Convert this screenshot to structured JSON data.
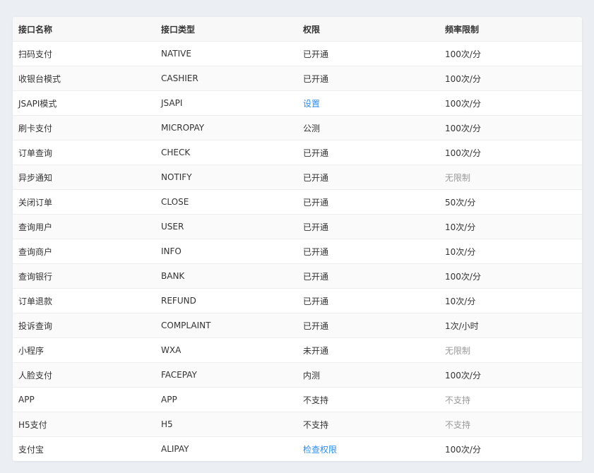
{
  "colors": {
    "link": "#2d8cf0",
    "muted": "#999999",
    "text": "#333333"
  },
  "table": {
    "headers": [
      "接口名称",
      "接口类型",
      "权限",
      "频率限制"
    ],
    "rows": [
      {
        "name": "扫码支付",
        "type": "NATIVE",
        "permission": "已开通",
        "permission_style": "text",
        "rate": "100次/分",
        "rate_style": "text"
      },
      {
        "name": "收银台模式",
        "type": "CASHIER",
        "permission": "已开通",
        "permission_style": "text",
        "rate": "100次/分",
        "rate_style": "text"
      },
      {
        "name": "JSAPI模式",
        "type": "JSAPI",
        "permission": "设置",
        "permission_style": "link",
        "rate": "100次/分",
        "rate_style": "text"
      },
      {
        "name": "刷卡支付",
        "type": "MICROPAY",
        "permission": "公测",
        "permission_style": "text",
        "rate": "100次/分",
        "rate_style": "text"
      },
      {
        "name": "订单查询",
        "type": "CHECK",
        "permission": "已开通",
        "permission_style": "text",
        "rate": "100次/分",
        "rate_style": "text"
      },
      {
        "name": "异步通知",
        "type": "NOTIFY",
        "permission": "已开通",
        "permission_style": "text",
        "rate": "无限制",
        "rate_style": "muted"
      },
      {
        "name": "关闭订单",
        "type": "CLOSE",
        "permission": "已开通",
        "permission_style": "text",
        "rate": "50次/分",
        "rate_style": "text"
      },
      {
        "name": "查询用户",
        "type": "USER",
        "permission": "已开通",
        "permission_style": "text",
        "rate": "10次/分",
        "rate_style": "text"
      },
      {
        "name": "查询商户",
        "type": "INFO",
        "permission": "已开通",
        "permission_style": "text",
        "rate": "10次/分",
        "rate_style": "text"
      },
      {
        "name": "查询银行",
        "type": "BANK",
        "permission": "已开通",
        "permission_style": "text",
        "rate": "100次/分",
        "rate_style": "text"
      },
      {
        "name": "订单退款",
        "type": "REFUND",
        "permission": "已开通",
        "permission_style": "text",
        "rate": "10次/分",
        "rate_style": "text"
      },
      {
        "name": "投诉查询",
        "type": "COMPLAINT",
        "permission": "已开通",
        "permission_style": "text",
        "rate": "1次/小时",
        "rate_style": "text"
      },
      {
        "name": "小程序",
        "type": "WXA",
        "permission": "未开通",
        "permission_style": "text",
        "rate": "无限制",
        "rate_style": "muted"
      },
      {
        "name": "人脸支付",
        "type": "FACEPAY",
        "permission": "内测",
        "permission_style": "text",
        "rate": "100次/分",
        "rate_style": "text"
      },
      {
        "name": "APP",
        "type": "APP",
        "permission": "不支持",
        "permission_style": "text",
        "rate": "不支持",
        "rate_style": "muted"
      },
      {
        "name": "H5支付",
        "type": "H5",
        "permission": "不支持",
        "permission_style": "text",
        "rate": "不支持",
        "rate_style": "muted"
      },
      {
        "name": "支付宝",
        "type": "ALIPAY",
        "permission": "检查权限",
        "permission_style": "link",
        "rate": "100次/分",
        "rate_style": "text"
      }
    ]
  }
}
